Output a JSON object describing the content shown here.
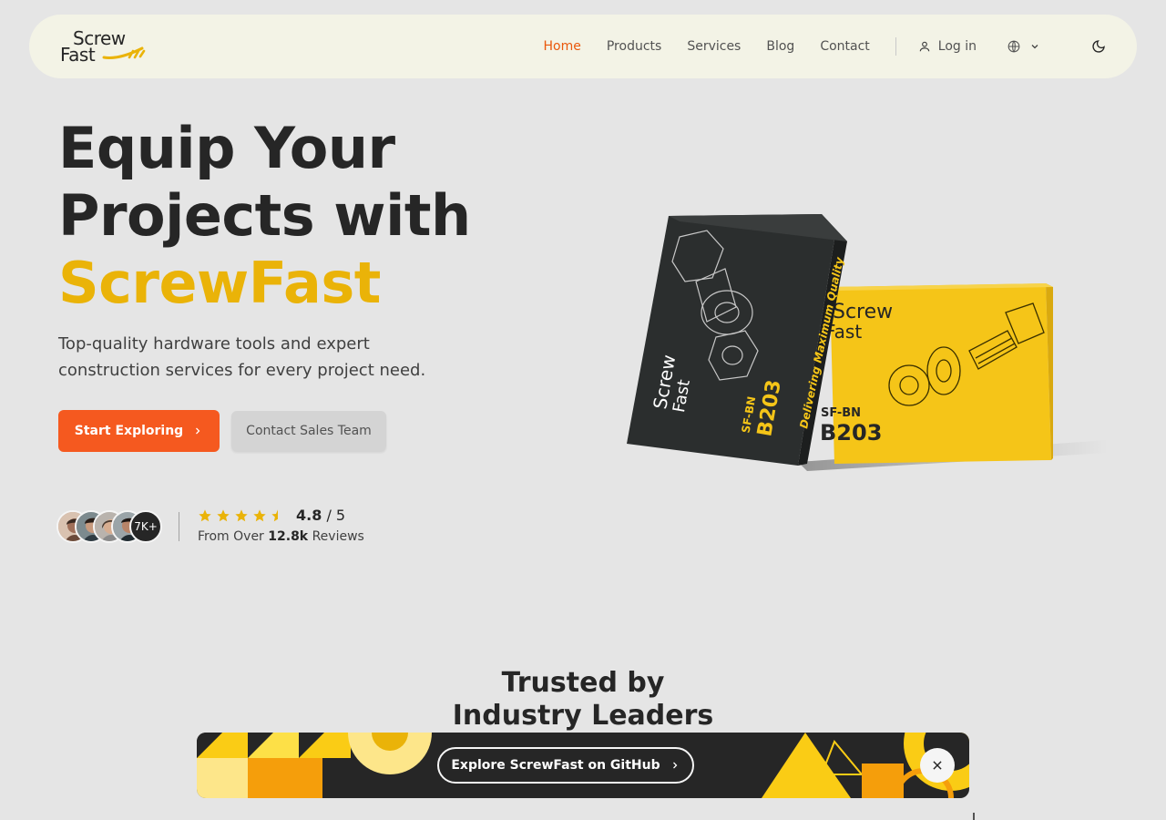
{
  "header": {
    "logo": {
      "line1": "Screw",
      "line2": "Fast"
    },
    "nav": [
      {
        "label": "Home",
        "active": true
      },
      {
        "label": "Products",
        "active": false
      },
      {
        "label": "Services",
        "active": false
      },
      {
        "label": "Blog",
        "active": false
      },
      {
        "label": "Contact",
        "active": false
      }
    ],
    "login_label": "Log in",
    "icons": {
      "login": "user-icon",
      "language": "globe-icon",
      "language_caret": "chevron-down-icon",
      "theme": "moon-icon"
    }
  },
  "hero": {
    "title_line1": "Equip Your",
    "title_line2": "Projects with",
    "title_accent": "ScrewFast",
    "subtitle": "Top-quality hardware tools and expert construction services for every project need.",
    "primary_button": "Start Exploring",
    "secondary_button": "Contact Sales Team"
  },
  "reviews": {
    "avatar_count_label": "7K+",
    "stars": 4.5,
    "rating_value": "4.8",
    "rating_suffix": "/ 5",
    "from_prefix": "From Over",
    "review_count": "12.8k",
    "from_suffix": "Reviews"
  },
  "product": {
    "box_dark": {
      "brand_line1": "Screw",
      "brand_line2": "Fast",
      "code": "SF-BN",
      "model": "B203",
      "tagline": "Delivering Maximum Quality"
    },
    "box_yellow": {
      "brand_line1": "Screw",
      "brand_line2": "Fast",
      "code": "SF-BN",
      "model": "B203"
    }
  },
  "trusted": {
    "line1": "Trusted by",
    "line2": "Industry Leaders"
  },
  "banner": {
    "button_label": "Explore ScrewFast on GitHub",
    "close_icon": "close-icon"
  },
  "colors": {
    "accent_orange": "#f5591f",
    "accent_yellow": "#eab308",
    "nav_active": "#ea580c",
    "header_bg": "#f3f3e6",
    "page_bg": "#e5e5e5"
  }
}
